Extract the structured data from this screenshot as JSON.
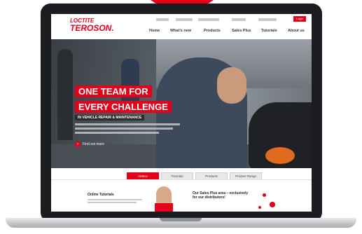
{
  "brand": {
    "logo_line1": "LOCTITE",
    "logo_line2": "TEROSON.",
    "accent_color": "#e2001a"
  },
  "header": {
    "login_label": "Login",
    "nav": [
      "Home",
      "What's new",
      "Products",
      "Sales Plus",
      "Tutorials",
      "About us"
    ]
  },
  "hero": {
    "headline_line1": "ONE TEAM FOR",
    "headline_line2": "EVERY CHALLENGE",
    "subheadline": "IN VEHICLE REPAIR & MAINTENANCE",
    "cta_label": "Find out more"
  },
  "tabs": [
    "Videos",
    "Tutorials",
    "Products",
    "Product Range"
  ],
  "teasers": {
    "left_title": "Online Tutorials",
    "right_title": "Our Sales Plus area – exclusively for our distributors!"
  },
  "icons": [
    "login-icon",
    "arrow-right-icon"
  ]
}
